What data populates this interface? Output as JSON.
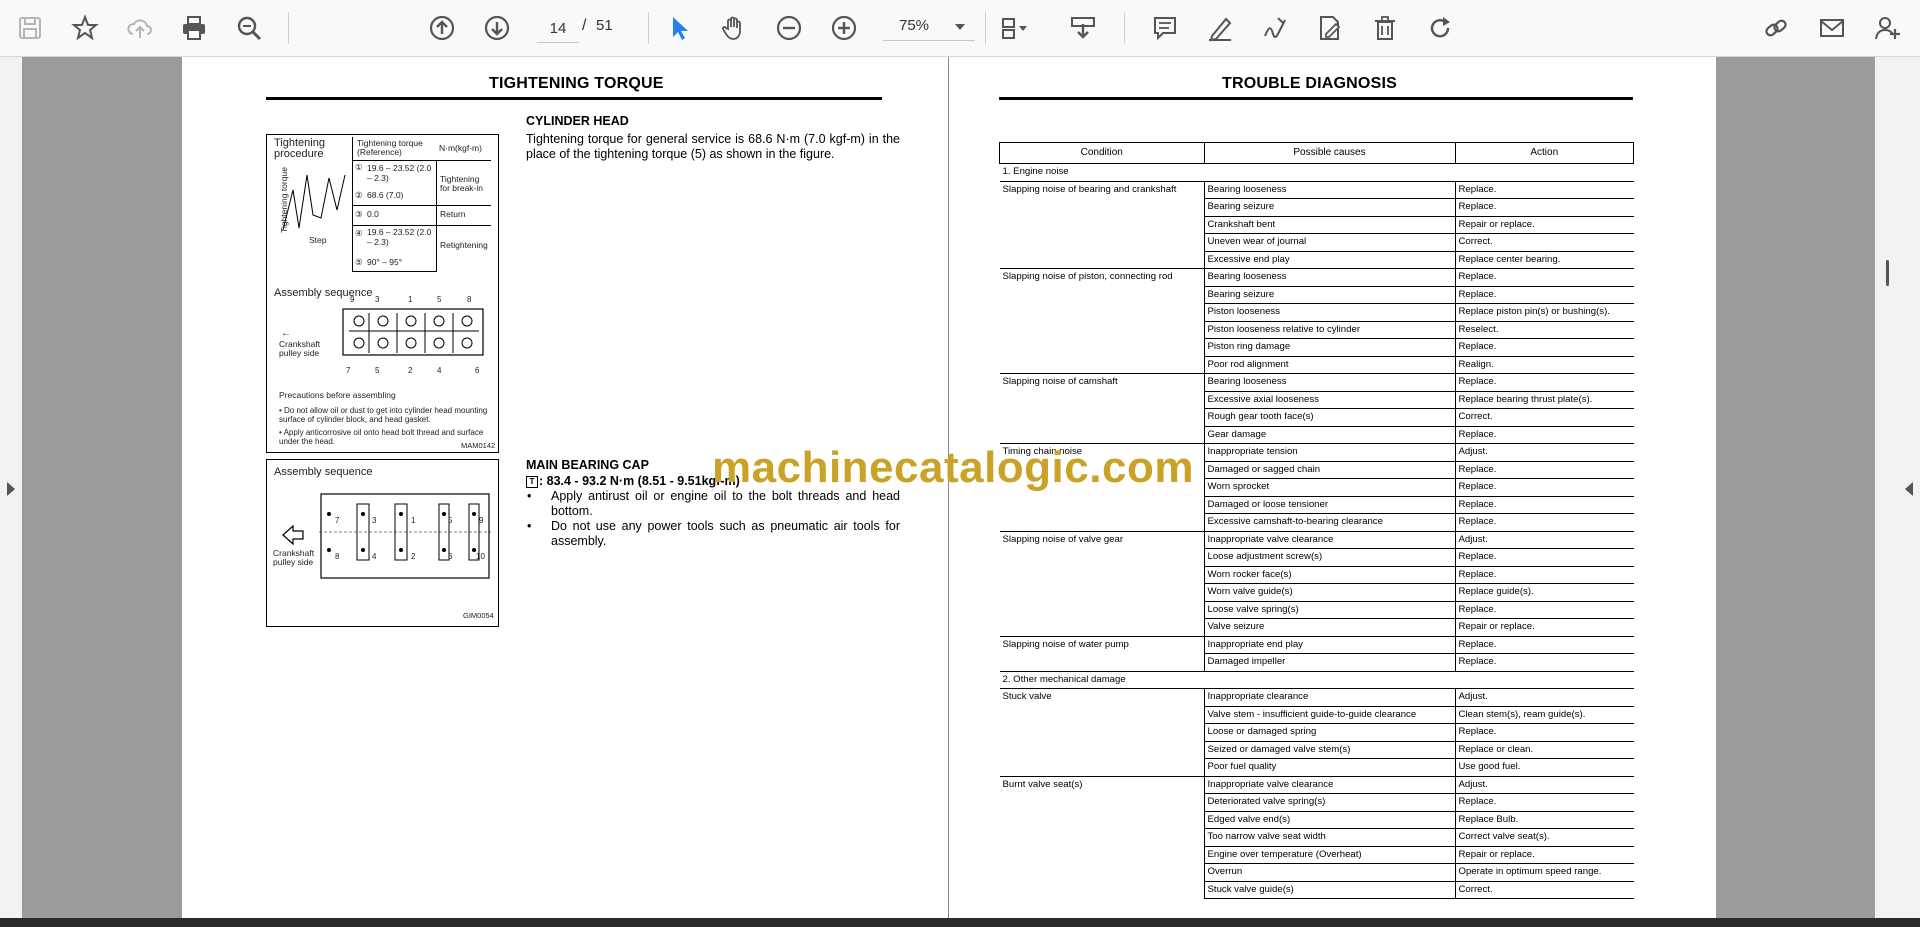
{
  "toolbar": {
    "current_page": "14",
    "separator": "/",
    "total_pages": "51",
    "zoom": "75%",
    "icons": [
      "save-icon",
      "bookmark-star-icon",
      "cloud-upload-icon",
      "print-icon",
      "zoom-search-icon",
      "page-up-icon",
      "page-down-icon",
      "select-pointer-icon",
      "hand-tool-icon",
      "zoom-out-icon",
      "zoom-in-icon",
      "page-layout-icon",
      "download-icon",
      "comment-icon",
      "highlight-pen-icon",
      "sign-icon",
      "edit-fill-icon",
      "delete-icon",
      "rotate-icon",
      "share-link-icon",
      "email-icon",
      "add-user-icon"
    ]
  },
  "left_page": {
    "title": "TIGHTENING TORQUE",
    "fig1": {
      "heading": "Tightening procedure",
      "col_header": "Tightening torque (Reference)",
      "unit": "N·m(kgf-m)",
      "axis_label": "Tightening torque",
      "step_label": "Step",
      "rows": [
        {
          "no": "①",
          "val": "19.6 – 23.52 (2.0 – 2.3)",
          "action": "Tightening for break-in"
        },
        {
          "no": "②",
          "val": "68.6 (7.0)",
          "action": ""
        },
        {
          "no": "③",
          "val": "0.0",
          "action": "Return"
        },
        {
          "no": "④",
          "val": "19.6 – 23.52 (2.0 – 2.3)",
          "action": "Retightening"
        },
        {
          "no": "⑤",
          "val": "90° – 95°",
          "action": ""
        }
      ],
      "seq_heading": "Assembly sequence",
      "seq_top": [
        "9",
        "3",
        "1",
        "5",
        "8"
      ],
      "seq_bottom": [
        "7",
        "5",
        "2",
        "4",
        "6"
      ],
      "pulley_label": "Crankshaft pulley side",
      "prec_heading": "Precautions before assembling",
      "prec_items": [
        "• Do not allow oil or dust to get into cylinder head mounting surface of cylinder block, and head gasket.",
        "• Apply anticorrosive oil onto head bolt thread and surface under the head."
      ],
      "code": "MAM0142"
    },
    "fig2": {
      "heading": "Assembly sequence",
      "pulley_label": "Crankshaft pulley side",
      "numbers": [
        "7",
        "3",
        "1",
        "5",
        "9",
        "8",
        "4",
        "2",
        "6",
        "10"
      ],
      "code": "GIM0054"
    },
    "section1": {
      "title": "CYLINDER HEAD",
      "text": "Tightening torque for general service is 68.6 N·m (7.0 kgf-m) in the place of the tightening torque (5) as shown in the figure."
    },
    "section2": {
      "title": "MAIN BEARING CAP",
      "torque": ": 83.4 - 93.2 N·m (8.51 - 9.51kgf-m)",
      "bullets": [
        "Apply antirust oil or engine oil to the bolt threads and head bottom.",
        "Do not use any power tools such as pneumatic air tools for assembly."
      ]
    }
  },
  "right_page": {
    "title": "TROUBLE DIAGNOSIS",
    "table": {
      "headers": [
        "Condition",
        "Possible causes",
        "Action"
      ],
      "groups": [
        {
          "section": "1. Engine noise"
        },
        {
          "condition": "Slapping noise of bearing and crankshaft",
          "rows": [
            [
              "Bearing looseness",
              "Replace."
            ],
            [
              "Bearing seizure",
              "Replace."
            ],
            [
              "Crankshaft bent",
              "Repair or replace."
            ],
            [
              "Uneven wear of journal",
              "Correct."
            ],
            [
              "Excessive end play",
              "Replace center bearing."
            ]
          ]
        },
        {
          "condition": "Slapping noise of piston, connecting rod",
          "rows": [
            [
              "Bearing looseness",
              "Replace."
            ],
            [
              "Bearing seizure",
              "Replace."
            ],
            [
              "Piston looseness",
              "Replace piston pin(s) or bushing(s)."
            ],
            [
              "Piston looseness relative to cylinder",
              "Reselect."
            ],
            [
              "Piston ring damage",
              "Replace."
            ],
            [
              "Poor rod alignment",
              "Realign."
            ]
          ]
        },
        {
          "condition": "Slapping noise of camshaft",
          "rows": [
            [
              "Bearing looseness",
              "Replace."
            ],
            [
              "Excessive axial looseness",
              "Replace bearing thrust plate(s)."
            ],
            [
              "Rough gear tooth face(s)",
              "Correct."
            ],
            [
              "Gear damage",
              "Replace."
            ]
          ]
        },
        {
          "condition": "Timing chain noise",
          "rows": [
            [
              "Inappropriate tension",
              "Adjust."
            ],
            [
              "Damaged or sagged chain",
              "Replace."
            ],
            [
              "Worn sprocket",
              "Replace."
            ],
            [
              "Damaged or loose tensioner",
              "Replace."
            ],
            [
              "Excessive camshaft-to-bearing clearance",
              "Replace."
            ]
          ]
        },
        {
          "condition": "Slapping noise of valve gear",
          "rows": [
            [
              "Inappropriate valve clearance",
              "Adjust."
            ],
            [
              "Loose adjustment screw(s)",
              "Replace."
            ],
            [
              "Worn rocker face(s)",
              "Replace."
            ],
            [
              "Worn valve guide(s)",
              "Replace guide(s)."
            ],
            [
              "Loose valve spring(s)",
              "Replace."
            ],
            [
              "Valve seizure",
              "Repair or replace."
            ]
          ]
        },
        {
          "condition": "Slapping noise of water pump",
          "rows": [
            [
              "Inappropriate end play",
              "Replace."
            ],
            [
              "Damaged impeller",
              "Replace."
            ]
          ]
        },
        {
          "section": "2. Other mechanical damage"
        },
        {
          "condition": "Stuck valve",
          "rows": [
            [
              "Inappropriate clearance",
              "Adjust."
            ],
            [
              "Valve stem - insufficient guide-to-guide clearance",
              "Clean stem(s), ream guide(s)."
            ],
            [
              "Loose or damaged spring",
              "Replace."
            ],
            [
              "Seized or damaged valve stem(s)",
              "Replace or clean."
            ],
            [
              "Poor fuel quality",
              "Use good fuel."
            ]
          ]
        },
        {
          "condition": "Burnt valve seat(s)",
          "rows": [
            [
              "Inappropriate valve clearance",
              "Adjust."
            ],
            [
              "Deteriorated valve spring(s)",
              "Replace."
            ],
            [
              "Edged valve end(s)",
              "Replace Bulb."
            ],
            [
              "Too narrow valve seat width",
              "Correct valve seat(s)."
            ],
            [
              "Engine over temperature (Overheat)",
              "Repair or replace."
            ],
            [
              "Overrun",
              "Operate in optimum speed range."
            ],
            [
              "Stuck valve guide(s)",
              "Correct."
            ]
          ]
        }
      ]
    }
  },
  "watermark": "machinecatalogic.com"
}
